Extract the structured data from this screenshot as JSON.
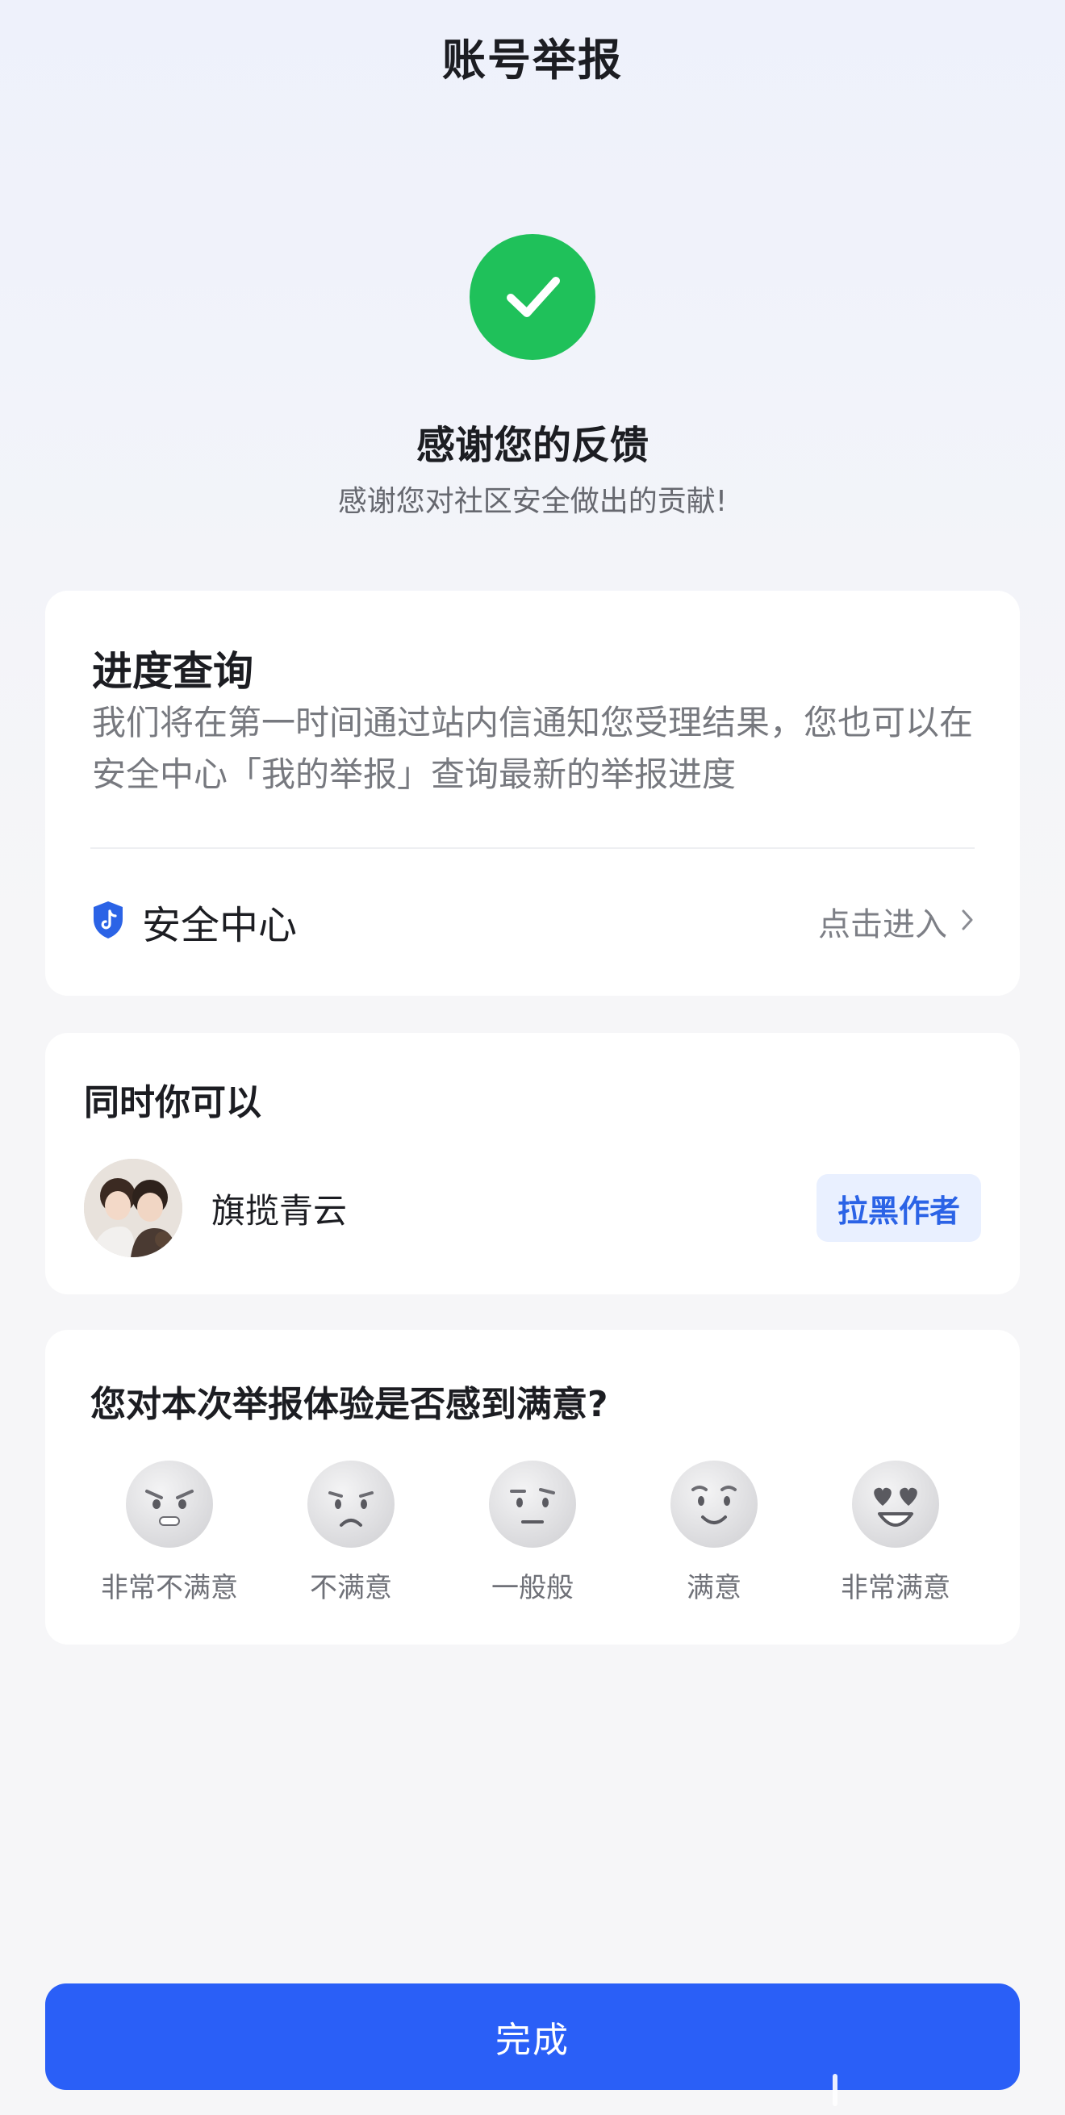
{
  "header": {
    "title": "账号举报"
  },
  "success": {
    "title": "感谢您的反馈",
    "subtitle": "感谢您对社区安全做出的贡献!"
  },
  "progress_card": {
    "title": "进度查询",
    "description": "我们将在第一时间通过站内信通知您受理结果，您也可以在安全中心「我的举报」查询最新的举报进度",
    "security_center_label": "安全中心",
    "enter_label": "点击进入"
  },
  "also_card": {
    "title": "同时你可以",
    "author_name": "旗揽青云",
    "block_label": "拉黑作者"
  },
  "survey_card": {
    "title": "您对本次举报体验是否感到满意?",
    "options": [
      "非常不满意",
      "不满意",
      "一般般",
      "满意",
      "非常满意"
    ]
  },
  "footer": {
    "done_label": "完成"
  },
  "colors": {
    "accent": "#2a5ff7",
    "success": "#1fc15a",
    "block_button_bg": "#e9f0ff",
    "block_button_text": "#2b63e6"
  },
  "icons": [
    "check-icon",
    "shield-icon",
    "chevron-right-icon",
    "avatar",
    "emoji-very-unsatisfied-icon",
    "emoji-unsatisfied-icon",
    "emoji-neutral-icon",
    "emoji-satisfied-icon",
    "emoji-very-satisfied-icon"
  ]
}
